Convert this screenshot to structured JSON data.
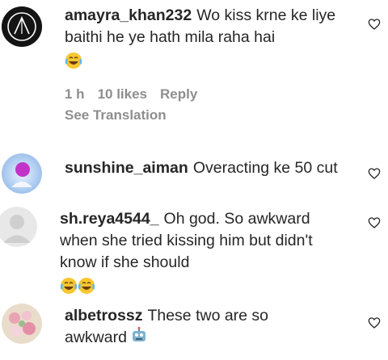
{
  "comments": [
    {
      "username": "amayra_khan232",
      "text": "Wo kiss krne ke liye baithi he ye hath mila raha hai",
      "emoji": "laughing-tears-emoji",
      "time": "1 h",
      "likes": "10 likes",
      "reply": "Reply",
      "translation": "See Translation"
    },
    {
      "username": "sunshine_aiman",
      "text": "Overacting ke 50 cut"
    },
    {
      "username": "sh.reya4544_",
      "text": "Oh god. So awkward when she tried kissing him but didn't know if she should",
      "emoji": "laughing-tears-emoji x2"
    },
    {
      "username": "albetrossz",
      "text": "These two are so awkward",
      "emoji": "robot-face-emoji"
    }
  ],
  "icons": {
    "like": "heart-outline-icon"
  },
  "colors": {
    "text": "#262626",
    "meta": "#8e8e8e"
  }
}
